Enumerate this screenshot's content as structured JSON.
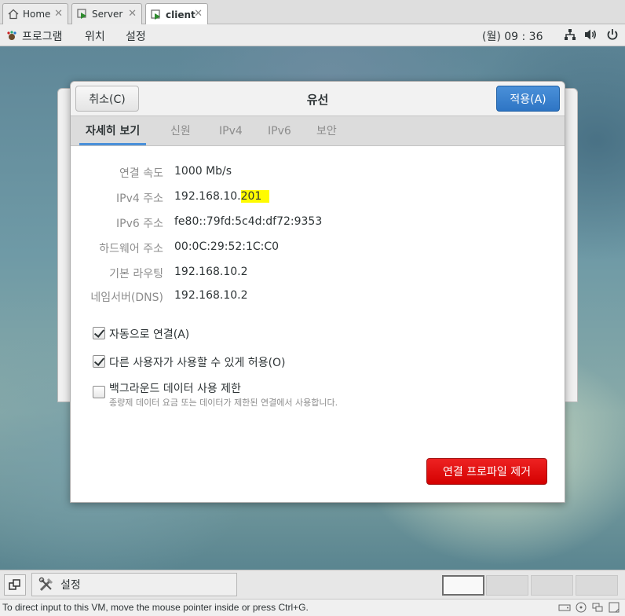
{
  "vm_tabs": [
    {
      "label": "Home",
      "icon": "home-icon"
    },
    {
      "label": "Server",
      "icon": "vm-icon"
    },
    {
      "label": "client",
      "icon": "vm-icon"
    }
  ],
  "top_bar": {
    "menus": [
      "프로그램",
      "위치",
      "설정"
    ],
    "clock": "(월) 09 : 36",
    "icons": [
      "network-icon",
      "volume-icon",
      "power-icon"
    ]
  },
  "dialog": {
    "cancel_label": "취소(C)",
    "title": "유선",
    "apply_label": "적용(A)",
    "tabs": [
      "자세히 보기",
      "신원",
      "IPv4",
      "IPv6",
      "보안"
    ],
    "active_tab": "자세히 보기",
    "details": [
      {
        "label": "연결 속도",
        "value": "1000 Mb/s"
      },
      {
        "label": "IPv4 주소",
        "value_prefix": "192.168.10.",
        "value_highlight": "201"
      },
      {
        "label": "IPv6 주소",
        "value": "fe80::79fd:5c4d:df72:9353"
      },
      {
        "label": "하드웨어 주소",
        "value": "00:0C:29:52:1C:C0"
      },
      {
        "label": "기본 라우팅",
        "value": "192.168.10.2"
      },
      {
        "label": "네임서버(DNS)",
        "value": "192.168.10.2"
      }
    ],
    "checkboxes": [
      {
        "label": "자동으로 연결(A)",
        "checked": true
      },
      {
        "label": "다른 사용자가 사용할 수 있게 허용(O)",
        "checked": true
      },
      {
        "label": "백그라운드 데이터 사용 제한",
        "sublabel": "종량제 데이터 요금 또는 데이터가 제한된 연결에서 사용합니다.",
        "checked": false
      }
    ],
    "remove_label": "연결 프로파일 제거",
    "highlight_color": "#fffb00"
  },
  "taskbar": {
    "window_label": "설정"
  },
  "status_text": "To direct input to this VM, move the mouse pointer inside or press Ctrl+G.",
  "colors": {
    "apply_blue": "#3a82cf",
    "remove_red": "#e01b1b",
    "tab_underline": "#4a90d9"
  }
}
